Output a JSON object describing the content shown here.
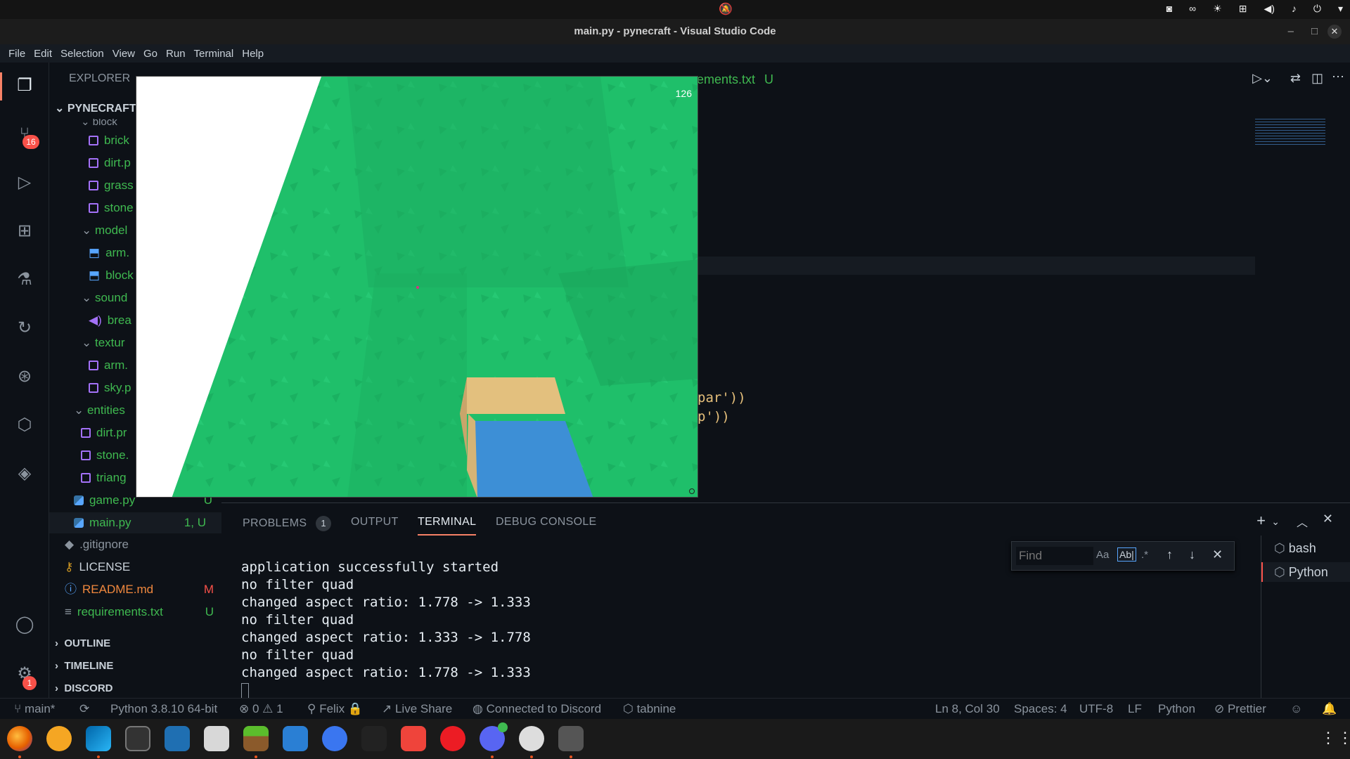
{
  "os": {
    "topbar_center_icon": "bell-off-icon",
    "tray_icons": [
      "discord-icon",
      "infinity-icon",
      "brightness-icon",
      "network-icon",
      "volume-icon",
      "microphone-icon",
      "power-icon",
      "chevron-down-icon"
    ]
  },
  "window": {
    "title": "main.py - pynecraft - Visual Studio Code",
    "controls": [
      "minimize",
      "maximize",
      "close"
    ]
  },
  "menu": [
    "File",
    "Edit",
    "Selection",
    "View",
    "Go",
    "Run",
    "Terminal",
    "Help"
  ],
  "activity": {
    "source_control_badge": "16",
    "settings_badge": "1"
  },
  "sidebar": {
    "header": "EXPLORER",
    "root": "PYNECRAFT",
    "items": [
      {
        "label": "block",
        "kind": "folder-open",
        "indent": 2
      },
      {
        "label": "brick",
        "kind": "image",
        "indent": 3,
        "color": "green"
      },
      {
        "label": "dirt.p",
        "kind": "image",
        "indent": 3,
        "color": "green"
      },
      {
        "label": "grass",
        "kind": "image",
        "indent": 3,
        "color": "green"
      },
      {
        "label": "stone",
        "kind": "image",
        "indent": 3,
        "color": "green"
      },
      {
        "label": "model",
        "kind": "folder-open",
        "indent": 2,
        "color": "green"
      },
      {
        "label": "arm.",
        "kind": "model",
        "indent": 3,
        "color": "green"
      },
      {
        "label": "block",
        "kind": "model",
        "indent": 3,
        "color": "green"
      },
      {
        "label": "sound",
        "kind": "folder-open",
        "indent": 2,
        "color": "green"
      },
      {
        "label": "brea",
        "kind": "audio",
        "indent": 3,
        "color": "green"
      },
      {
        "label": "textur",
        "kind": "folder-open",
        "indent": 2,
        "color": "green"
      },
      {
        "label": "arm.",
        "kind": "image",
        "indent": 3,
        "color": "green"
      },
      {
        "label": "sky.p",
        "kind": "image",
        "indent": 3,
        "color": "green"
      },
      {
        "label": "entities",
        "kind": "folder-open",
        "indent": 1,
        "color": "green"
      },
      {
        "label": "dirt.pr",
        "kind": "image",
        "indent": 2,
        "color": "green"
      },
      {
        "label": "stone.",
        "kind": "image",
        "indent": 2,
        "color": "green"
      },
      {
        "label": "triang",
        "kind": "image",
        "indent": 2,
        "color": "green"
      },
      {
        "label": "game.py",
        "kind": "python",
        "indent": 1,
        "color": "green",
        "status": "U"
      },
      {
        "label": "main.py",
        "kind": "python",
        "indent": 1,
        "color": "green",
        "status": "1, U",
        "selected": true
      },
      {
        "label": ".gitignore",
        "kind": "git",
        "indent": 0,
        "color": "gray"
      },
      {
        "label": "LICENSE",
        "kind": "license",
        "indent": 0,
        "color": "gray"
      },
      {
        "label": "README.md",
        "kind": "info",
        "indent": 0,
        "color": "orange",
        "status": "M"
      },
      {
        "label": "requirements.txt",
        "kind": "text",
        "indent": 0,
        "color": "green",
        "status": "U"
      }
    ],
    "sections": [
      "OUTLINE",
      "TIMELINE",
      "DISCORD"
    ]
  },
  "editor": {
    "visible_tab": "rements.txt",
    "visible_tab_status": "U",
    "code_fragments": [
      "par'))",
      "p'))"
    ]
  },
  "game": {
    "fps": "126"
  },
  "panel": {
    "tabs": [
      "PROBLEMS",
      "OUTPUT",
      "TERMINAL",
      "DEBUG CONSOLE"
    ],
    "problems_count": "1",
    "active_tab": "TERMINAL",
    "terminal_lines": [
      "application successfully started",
      "no filter quad",
      "changed aspect ratio: 1.778 -> 1.333",
      "no filter quad",
      "changed aspect ratio: 1.333 -> 1.778",
      "no filter quad",
      "changed aspect ratio: 1.778 -> 1.333"
    ],
    "find_placeholder": "Find",
    "find_options": [
      "Aa",
      "Ab|",
      ".*"
    ],
    "terminals": [
      "bash",
      "Python"
    ]
  },
  "status": {
    "branch": "main*",
    "python": "Python 3.8.10 64-bit",
    "errors": "0",
    "warnings": "1",
    "user": "Felix",
    "liveshare": "Live Share",
    "discord": "Connected to Discord",
    "tabnine": "tabnine",
    "position": "Ln 8, Col 30",
    "spaces": "Spaces: 4",
    "encoding": "UTF-8",
    "eol": "LF",
    "language": "Python",
    "formatter": "Prettier"
  },
  "taskbar": {
    "apps": [
      "firefox-icon",
      "ubuntu-dash-icon",
      "vscode-icon",
      "terminal-icon",
      "books-icon",
      "files-icon",
      "minecraft-icon",
      "monitor-icon",
      "signal-icon",
      "inkscape-icon",
      "anydesk-icon",
      "authy-icon",
      "discord-icon",
      "software-updater-icon",
      "gimp-icon"
    ],
    "grid": "app-grid-icon"
  },
  "colors": {
    "accent": "#3fb950",
    "badge": "#f85149",
    "game_grass": "#1fbf6a"
  }
}
